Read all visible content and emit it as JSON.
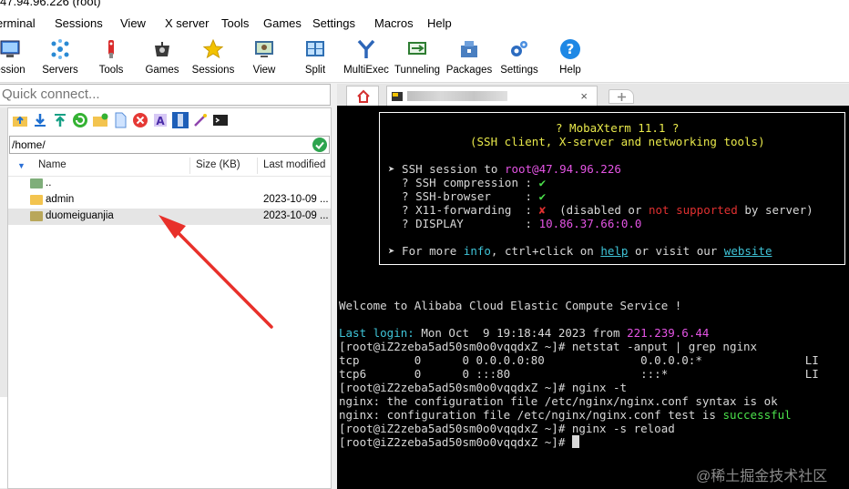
{
  "window": {
    "title": "47.94.96.226 (root)"
  },
  "menu": [
    "erminal",
    "Sessions",
    "View",
    "X server",
    "Tools",
    "Games",
    "Settings",
    "Macros",
    "Help"
  ],
  "toolbar": [
    {
      "label": "ession",
      "icon": "session-icon"
    },
    {
      "label": "Servers",
      "icon": "servers-icon"
    },
    {
      "label": "Tools",
      "icon": "tools-icon"
    },
    {
      "label": "Games",
      "icon": "games-icon"
    },
    {
      "label": "Sessions",
      "icon": "sessions-star-icon"
    },
    {
      "label": "View",
      "icon": "view-icon"
    },
    {
      "label": "Split",
      "icon": "split-icon"
    },
    {
      "label": "MultiExec",
      "icon": "multiexec-icon"
    },
    {
      "label": "Tunneling",
      "icon": "tunneling-icon"
    },
    {
      "label": "Packages",
      "icon": "packages-icon"
    },
    {
      "label": "Settings",
      "icon": "settings-icon"
    },
    {
      "label": "Help",
      "icon": "help-icon"
    }
  ],
  "quick_connect": {
    "placeholder": "Quick connect..."
  },
  "browser": {
    "path": "/home/",
    "columns": {
      "name": "Name",
      "size": "Size (KB)",
      "modified": "Last modified"
    },
    "rows": [
      {
        "name": "..",
        "modified": ""
      },
      {
        "name": "admin",
        "modified": "2023-10-09 ..."
      },
      {
        "name": "duomeiguanjia",
        "modified": "2023-10-09 ..."
      }
    ]
  },
  "tabs": {
    "close": "×"
  },
  "terminal": {
    "banner_title": "? MobaXterm 11.1 ?",
    "banner_sub": "(SSH client, X-server and networking tools)",
    "ssh_session_label": "➤ SSH session to ",
    "ssh_user": "root",
    "ssh_host": "@47.94.96.226",
    "compression_label": "  ? SSH compression : ",
    "compression_val": "✔",
    "browser_label": "  ? SSH-browser     : ",
    "browser_val": "✔",
    "x11_label": "  ? X11-forwarding  : ",
    "x11_val": "✘",
    "x11_note_a": "  (disabled or ",
    "x11_note_b": "not supported",
    "x11_note_c": " by server)",
    "display_label": "  ? DISPLAY         : ",
    "display_val": "10.86.37.66:0.0",
    "more_a": "➤ For more ",
    "more_info": "info",
    "more_b": ", ctrl+click on ",
    "more_help": "help",
    "more_c": " or visit our ",
    "more_site": "website",
    "welcome": "Welcome to Alibaba Cloud Elastic Compute Service !",
    "last_login_label": "Last login:",
    "last_login_date": " Mon Oct  9 19:18:44 2023 from ",
    "last_login_ip": "221.239.6.44",
    "lines": [
      "[root@iZ2zeba5ad50sm0o0vqqdxZ ~]# netstat -anput | grep nginx",
      "tcp        0      0 0.0.0.0:80              0.0.0.0:*               LI",
      "tcp6       0      0 :::80                   :::*                    LI",
      "[root@iZ2zeba5ad50sm0o0vqqdxZ ~]# nginx -t",
      "nginx: the configuration file /etc/nginx/nginx.conf syntax is ok"
    ],
    "test_line": "nginx: configuration file /etc/nginx/nginx.conf test is ",
    "test_ok": "successful",
    "reload_line": "[root@iZ2zeba5ad50sm0o0vqqdxZ ~]# nginx -s reload",
    "prompt": "[root@iZ2zeba5ad50sm0o0vqqdxZ ~]# "
  },
  "watermark": "@稀土掘金技术社区"
}
